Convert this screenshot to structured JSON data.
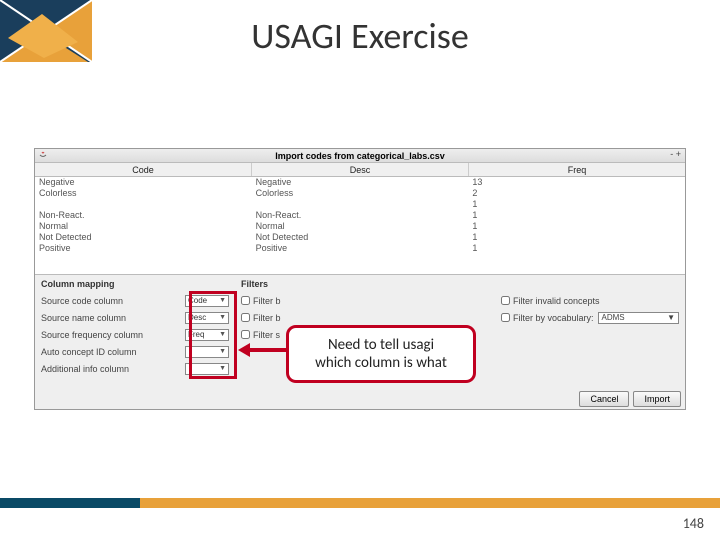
{
  "slide": {
    "title": "USAGI Exercise",
    "page": "148"
  },
  "app": {
    "window_title": "Import codes from categorical_labs.csv",
    "minmax": "- +",
    "columns": {
      "code": "Code",
      "desc": "Desc",
      "freq": "Freq"
    },
    "rows": [
      {
        "code": "Negative",
        "desc": "Negative",
        "freq": "13"
      },
      {
        "code": "Colorless",
        "desc": "Colorless",
        "freq": "2"
      },
      {
        "code": "",
        "desc": "",
        "freq": "1"
      },
      {
        "code": "Non-React.",
        "desc": "Non-React.",
        "freq": "1"
      },
      {
        "code": "Normal",
        "desc": "Normal",
        "freq": "1"
      },
      {
        "code": "Not Detected",
        "desc": "Not Detected",
        "freq": "1"
      },
      {
        "code": "Positive",
        "desc": "Positive",
        "freq": "1"
      }
    ],
    "mapping": {
      "heading": "Column mapping",
      "items": [
        {
          "label": "Source code column",
          "value": "Code"
        },
        {
          "label": "Source name column",
          "value": "Desc"
        },
        {
          "label": "Source frequency column",
          "value": "Freq"
        },
        {
          "label": "Auto concept ID column",
          "value": ""
        },
        {
          "label": "Additional info column",
          "value": ""
        }
      ]
    },
    "filters": {
      "heading": "Filters",
      "f1_label": "Filter b",
      "f2_label": "Filter b",
      "f3_label": "Filter s",
      "right1": "Filter invalid concepts",
      "right2": "Filter by vocabulary:",
      "vocab": "ADMS"
    },
    "buttons": {
      "cancel": "Cancel",
      "import": "Import"
    }
  },
  "callout": {
    "l1": "Need to tell usagi",
    "l2": "which column is what"
  }
}
